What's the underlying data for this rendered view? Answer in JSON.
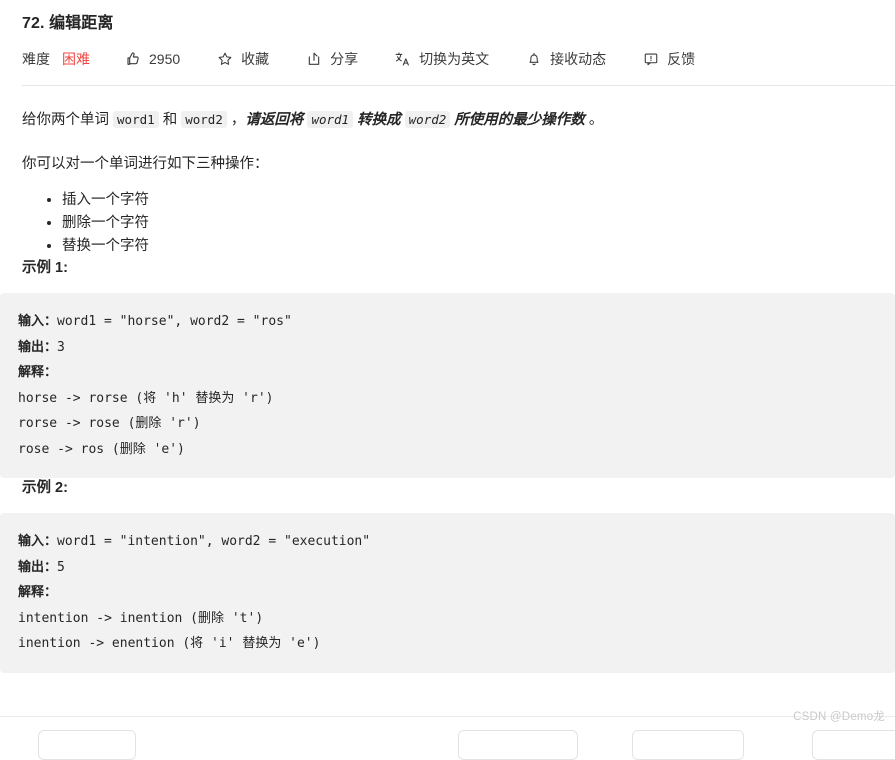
{
  "header": {
    "title": "72. 编辑距离",
    "difficulty_label": "难度",
    "difficulty_value": "困难",
    "difficulty_color": "#ef4743",
    "like_count": "2950",
    "like_icon": "thumbs-up-icon",
    "favorite_label": "收藏",
    "favorite_icon": "star-icon",
    "share_label": "分享",
    "share_icon": "share-icon",
    "translate_label": "切换为英文",
    "translate_icon": "translate-icon",
    "subscribe_label": "接收动态",
    "subscribe_icon": "bell-icon",
    "feedback_label": "反馈",
    "feedback_icon": "feedback-icon"
  },
  "description": {
    "p1_a": "给你两个单词 ",
    "p1_code1": "word1",
    "p1_b": " 和 ",
    "p1_code2": "word2",
    "p1_c": " ，",
    "p1_em1": "请返回将 ",
    "p1_code3": "word1",
    "p1_em2": " 转换成 ",
    "p1_code4": "word2",
    "p1_em3": " 所使用的最少操作数",
    "p1_d": " 。",
    "p2": "你可以对一个单词进行如下三种操作：",
    "operations": [
      "插入一个字符",
      "删除一个字符",
      "替换一个字符"
    ]
  },
  "examples": [
    {
      "heading": "示例 1:",
      "input_label": "输入：",
      "input_value": "word1 = \"horse\", word2 = \"ros\"",
      "output_label": "输出：",
      "output_value": "3",
      "explain_label": "解释：",
      "explain_lines": [
        "horse -> rorse (将 'h' 替换为 'r')",
        "rorse -> rose (删除 'r')",
        "rose -> ros (删除 'e')"
      ]
    },
    {
      "heading": "示例 2:",
      "input_label": "输入：",
      "input_value": "word1 = \"intention\", word2 = \"execution\"",
      "output_label": "输出：",
      "output_value": "5",
      "explain_label": "解释：",
      "explain_lines": [
        "intention -> inention (删除 't')",
        "inention -> enention (将 'i' 替换为 'e')"
      ]
    }
  ],
  "footer": {
    "watermark": "CSDN @Demo龙"
  }
}
